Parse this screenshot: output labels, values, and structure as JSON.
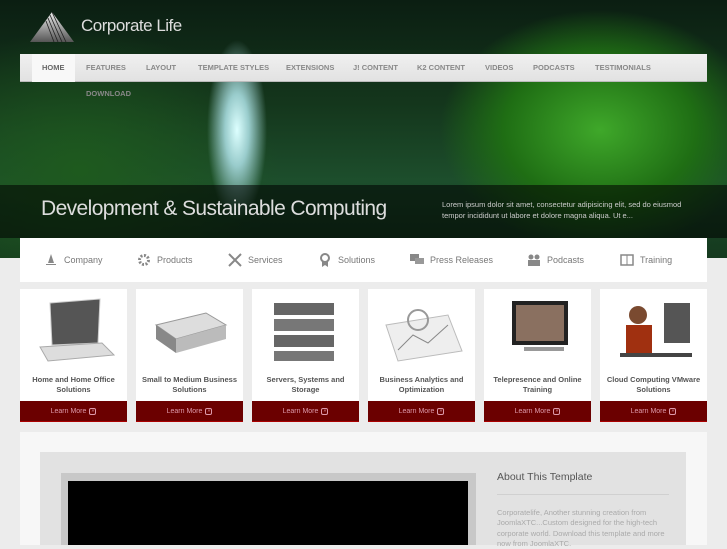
{
  "brand": {
    "name": "Corporate Life"
  },
  "nav": {
    "items": [
      "HOME",
      "FEATURES",
      "LAYOUT",
      "TEMPLATE STYLES",
      "EXTENSIONS",
      "J! CONTENT",
      "K2 CONTENT",
      "VIDEOS",
      "PODCASTS",
      "TESTIMONIALS"
    ],
    "second_row": "DOWNLOAD",
    "active": "HOME"
  },
  "hero": {
    "title": "Development & Sustainable Computing",
    "description": "Lorem ipsum dolor sit amet, consectetur adipisicing elit, sed do eiusmod tempor incididunt ut labore et dolore magna aliqua. Ut e..."
  },
  "iconbar": [
    {
      "label": "Company",
      "icon": "bell-icon"
    },
    {
      "label": "Products",
      "icon": "gear-icon"
    },
    {
      "label": "Services",
      "icon": "tools-icon"
    },
    {
      "label": "Solutions",
      "icon": "award-icon"
    },
    {
      "label": "Press Releases",
      "icon": "chat-icon"
    },
    {
      "label": "Podcasts",
      "icon": "users-icon"
    },
    {
      "label": "Training",
      "icon": "book-icon"
    }
  ],
  "cards": [
    {
      "title": "Home and Home Office Solutions",
      "button": "Learn More"
    },
    {
      "title": "Small to Medium Business Solutions",
      "button": "Learn More"
    },
    {
      "title": "Servers, Systems and Storage",
      "button": "Learn More"
    },
    {
      "title": "Business Analytics and Optimization",
      "button": "Learn More"
    },
    {
      "title": "Telepresence and Online Training",
      "button": "Learn More"
    },
    {
      "title": "Cloud Computing VMware Solutions",
      "button": "Learn More"
    }
  ],
  "about": {
    "title": "About This Template",
    "text": "Corporatelife, Another stunning creation from JoomlaXTC...Custom designed for the high-tech corporate world. Download this template and more now from JoomlaXTC."
  },
  "colors": {
    "accent": "#6b0000",
    "nav_bg": "#e8e8e8"
  }
}
